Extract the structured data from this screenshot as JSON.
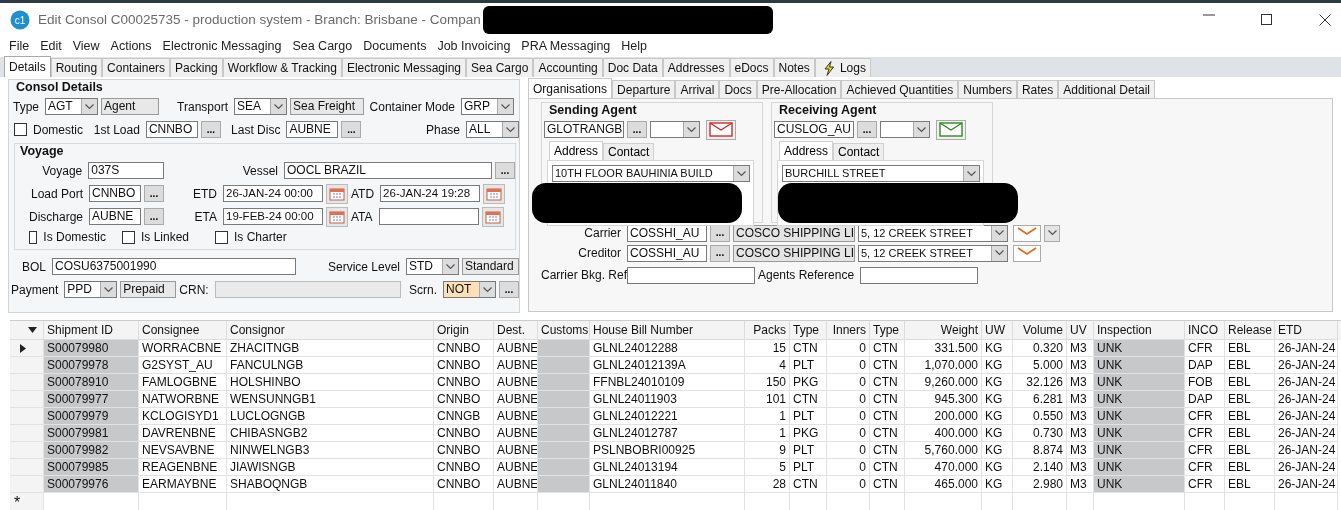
{
  "window": {
    "logo": "c1",
    "title": "Edit Consol C00025735 - production system - Branch: Brisbane - Compan"
  },
  "menu": [
    "File",
    "Edit",
    "View",
    "Actions",
    "Electronic Messaging",
    "Sea Cargo",
    "Documents",
    "Job Invoicing",
    "PRA Messaging",
    "Help"
  ],
  "tabs": [
    {
      "label": "Details",
      "selected": true,
      "kind": "plain"
    },
    {
      "label": "Routing",
      "selected": false,
      "kind": "plain"
    },
    {
      "label": "Containers",
      "selected": false,
      "kind": "plain"
    },
    {
      "label": "Packing",
      "selected": false,
      "kind": "plain"
    },
    {
      "label": "Workflow & Tracking",
      "selected": false,
      "kind": "plain"
    },
    {
      "label": "Electronic Messaging",
      "selected": false,
      "kind": "plain"
    },
    {
      "label": "Sea Cargo",
      "selected": false,
      "kind": "plain"
    },
    {
      "label": "Accounting",
      "selected": false,
      "kind": "plain"
    },
    {
      "label": "Doc Data",
      "selected": false,
      "kind": "plain"
    },
    {
      "label": "Addresses",
      "selected": false,
      "kind": "plain"
    },
    {
      "label": "eDocs",
      "selected": false,
      "kind": "plain"
    },
    {
      "label": "Notes",
      "selected": false,
      "kind": "plain"
    },
    {
      "label": "Logs",
      "selected": false,
      "kind": "icon"
    }
  ],
  "consol_details": {
    "title": "Consol Details",
    "type": {
      "label": "Type",
      "code": "AGT",
      "description": "Agent"
    },
    "transport": {
      "label": "Transport",
      "code": "SEA",
      "description": "Sea Freight"
    },
    "container_mode": {
      "label": "Container Mode",
      "value": "GRP"
    },
    "domestic": {
      "label": "Domestic",
      "checked": false
    },
    "first_load": {
      "label": "1st Load",
      "value": "CNNBO",
      "button": "..."
    },
    "last_disc": {
      "label": "Last Disc",
      "value": "AUBNE",
      "button": "..."
    },
    "phase": {
      "label": "Phase",
      "value": "ALL"
    }
  },
  "voyage": {
    "title": "Voyage",
    "voyage": {
      "label": "Voyage",
      "value": "037S"
    },
    "vessel": {
      "label": "Vessel",
      "value": "OOCL BRAZIL",
      "button": "..."
    },
    "load_port": {
      "label": "Load Port",
      "value": "CNNBO",
      "button": "..."
    },
    "discharge": {
      "label": "Discharge",
      "value": "AUBNE",
      "button": "..."
    },
    "etd": {
      "label": "ETD",
      "value": "26-JAN-24 00:00"
    },
    "eta": {
      "label": "ETA",
      "value": "19-FEB-24 00:00"
    },
    "atd": {
      "label": "ATD",
      "value": "26-JAN-24 19:28"
    },
    "ata": {
      "label": "ATA"
    },
    "checkboxes": [
      {
        "label": "Is Domestic",
        "checked": false
      },
      {
        "label": "Is Linked",
        "checked": false
      },
      {
        "label": "Is Charter",
        "checked": false
      }
    ]
  },
  "bol": {
    "label": "BOL",
    "value": "COSU6375001990"
  },
  "service_level": {
    "label": "Service Level",
    "code": "STD",
    "description": "Standard"
  },
  "payment": {
    "label": "Payment",
    "code": "PPD",
    "description": "Prepaid"
  },
  "crn": {
    "label": "CRN:"
  },
  "scrn": {
    "label": "Scrn.",
    "value": "NOT",
    "button": "..."
  },
  "sub_tabs": [
    {
      "label": "Organisations",
      "selected": true
    },
    {
      "label": "Departure",
      "selected": false
    },
    {
      "label": "Arrival",
      "selected": false
    },
    {
      "label": "Docs",
      "selected": false
    },
    {
      "label": "Pre-Allocation",
      "selected": false
    },
    {
      "label": "Achieved Quantities",
      "selected": false
    },
    {
      "label": "Numbers",
      "selected": false
    },
    {
      "label": "Rates",
      "selected": false
    },
    {
      "label": "Additional Detail",
      "selected": false
    }
  ],
  "agents": [
    {
      "title": "Sending Agent",
      "code": "GLOTRANGB",
      "button": "...",
      "color": "#d42a2a",
      "address_tabs": [
        {
          "label": "Address",
          "selected": true
        },
        {
          "label": "Contact",
          "selected": false
        }
      ],
      "address": "10TH FLOOR BAUHINIA BUILD"
    },
    {
      "title": "Receiving Agent",
      "code": "CUSLOG_AU",
      "button": "...",
      "color": "#2e8b1e",
      "address_tabs": [
        {
          "label": "Address",
          "selected": true
        },
        {
          "label": "Contact",
          "selected": false
        }
      ],
      "address": "BURCHILL STREET"
    }
  ],
  "parties": [
    {
      "label": "Carrier",
      "code": "COSSHI_AU",
      "button": "...",
      "name": "COSCO SHIPPING LI",
      "address": "5, 12 CREEK STREET",
      "extra_dropdown": true
    },
    {
      "label": "Creditor",
      "code": "COSSHI_AU",
      "button": "...",
      "name": "COSCO SHIPPING LI",
      "address": "5, 12 CREEK STREET",
      "extra_dropdown": false
    }
  ],
  "carrier_bkg_ref": {
    "label": "Carrier Bkg. Ref"
  },
  "agents_reference": {
    "label": "Agents Reference"
  },
  "grid": {
    "columns": [
      {
        "label": "Shipment ID",
        "kind": "text",
        "shaded": true
      },
      {
        "label": "Consignee",
        "kind": "text",
        "shaded": false
      },
      {
        "label": "Consignor",
        "kind": "text",
        "shaded": false
      },
      {
        "label": "Origin",
        "kind": "text",
        "shaded": false
      },
      {
        "label": "Dest.",
        "kind": "text",
        "shaded": false
      },
      {
        "label": "Customs",
        "kind": "text",
        "shaded": true
      },
      {
        "label": "House Bill Number",
        "kind": "text",
        "shaded": false
      },
      {
        "label": "Packs",
        "kind": "number",
        "shaded": false
      },
      {
        "label": "Type",
        "kind": "text",
        "shaded": false
      },
      {
        "label": "Inners",
        "kind": "number",
        "shaded": false
      },
      {
        "label": "Type",
        "kind": "text",
        "shaded": false
      },
      {
        "label": "Weight",
        "kind": "number",
        "shaded": false
      },
      {
        "label": "UW",
        "kind": "text",
        "shaded": false
      },
      {
        "label": "Volume",
        "kind": "number",
        "shaded": false
      },
      {
        "label": "UV",
        "kind": "text",
        "shaded": false
      },
      {
        "label": "Inspection",
        "kind": "text",
        "shaded": true
      },
      {
        "label": "INCO",
        "kind": "text",
        "shaded": false
      },
      {
        "label": "Release",
        "kind": "text",
        "shaded": false
      },
      {
        "label": "ETD",
        "kind": "text",
        "shaded": false
      }
    ],
    "rows": [
      {
        "current": true,
        "cells": [
          "S00079980",
          "WORRACBNE",
          "ZHACITNGB",
          "CNNBO",
          "AUBNE",
          "",
          "GLNL24012288",
          "15",
          "CTN",
          "0",
          "CTN",
          "331.500",
          "KG",
          "0.320",
          "M3",
          "UNK",
          "CFR",
          "EBL",
          "26-JAN-24"
        ]
      },
      {
        "current": false,
        "cells": [
          "S00079978",
          "G2SYST_AU",
          "FANCULNGB",
          "CNNBO",
          "AUBNE",
          "",
          "GLNL24012139A",
          "4",
          "PLT",
          "0",
          "CTN",
          "1,070.000",
          "KG",
          "5.000",
          "M3",
          "UNK",
          "DAP",
          "EBL",
          "26-JAN-24"
        ]
      },
      {
        "current": false,
        "cells": [
          "S00078910",
          "FAMLOGBNE",
          "HOLSHINBO",
          "CNNBO",
          "AUBNE",
          "",
          "FFNBL24010109",
          "150",
          "PKG",
          "0",
          "CTN",
          "9,260.000",
          "KG",
          "32.126",
          "M3",
          "UNK",
          "FOB",
          "EBL",
          "26-JAN-24"
        ]
      },
      {
        "current": false,
        "cells": [
          "S00079977",
          "NATWORBNE",
          "WENSUNNGB1",
          "CNNBO",
          "AUBNE",
          "",
          "GLNL24011903",
          "101",
          "CTN",
          "0",
          "CTN",
          "945.300",
          "KG",
          "6.281",
          "M3",
          "UNK",
          "DAP",
          "EBL",
          "26-JAN-24"
        ]
      },
      {
        "current": false,
        "cells": [
          "S00079979",
          "KCLOGISYD1",
          "LUCLOGNGB",
          "CNNGB",
          "AUBNE",
          "",
          "GLNL24012221",
          "1",
          "PLT",
          "0",
          "CTN",
          "200.000",
          "KG",
          "0.550",
          "M3",
          "UNK",
          "CFR",
          "EBL",
          "26-JAN-24"
        ]
      },
      {
        "current": false,
        "cells": [
          "S00079981",
          "DAVRENBNE",
          "CHIBASNGB2",
          "CNNBO",
          "AUBNE",
          "",
          "GLNL24012787",
          "1",
          "PKG",
          "0",
          "CTN",
          "400.000",
          "KG",
          "0.730",
          "M3",
          "UNK",
          "CFR",
          "EBL",
          "26-JAN-24"
        ]
      },
      {
        "current": false,
        "cells": [
          "S00079982",
          "NEVSAVBNE",
          "NINWELNGB3",
          "CNNBO",
          "AUBNE",
          "",
          "PSLNBOBRI00925",
          "9",
          "PLT",
          "0",
          "CTN",
          "5,760.000",
          "KG",
          "8.874",
          "M3",
          "UNK",
          "CFR",
          "EBL",
          "26-JAN-24"
        ]
      },
      {
        "current": false,
        "cells": [
          "S00079985",
          "REAGENBNE",
          "JIAWISNGB",
          "CNNBO",
          "AUBNE",
          "",
          "GLNL24013194",
          "5",
          "PLT",
          "0",
          "CTN",
          "470.000",
          "KG",
          "2.140",
          "M3",
          "UNK",
          "CFR",
          "EBL",
          "26-JAN-24"
        ]
      },
      {
        "current": false,
        "cells": [
          "S00079976",
          "EARMAYBNE",
          "SHABOQNGB",
          "CNNBO",
          "AUBNE",
          "",
          "GLNL24011840",
          "28",
          "CTN",
          "0",
          "CTN",
          "465.000",
          "KG",
          "2.980",
          "M3",
          "UNK",
          "CFR",
          "EBL",
          "26-JAN-24"
        ]
      }
    ],
    "new_row_marker": "*"
  }
}
